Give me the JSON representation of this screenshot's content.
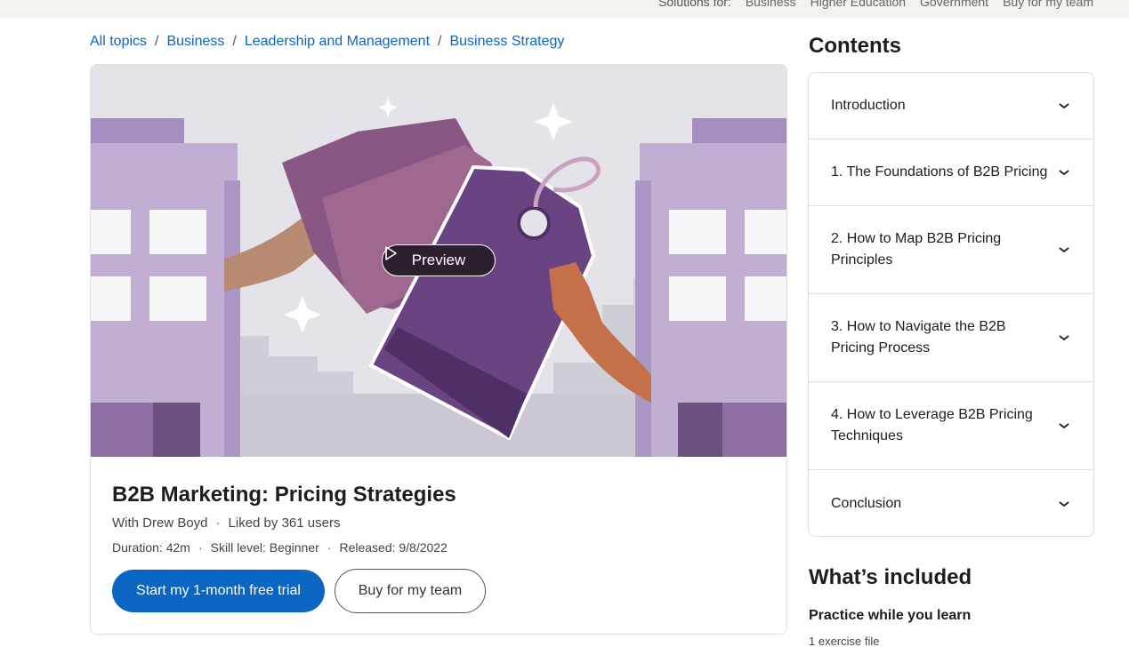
{
  "top_nav": {
    "label": "Solutions for:",
    "links": [
      "Business",
      "Higher Education",
      "Government",
      "Buy for my team"
    ]
  },
  "breadcrumb": [
    "All topics",
    "Business",
    "Leadership and Management",
    "Business Strategy"
  ],
  "course": {
    "preview_label": "Preview",
    "title": "B2B Marketing: Pricing Strategies",
    "author": "With Drew Boyd",
    "likes": "Liked by 361 users",
    "duration": "Duration: 42m",
    "skill_level": "Skill level: Beginner",
    "released": "Released: 9/8/2022",
    "primary_cta": "Start my 1-month free trial",
    "secondary_cta": "Buy for my team"
  },
  "contents": {
    "title": "Contents",
    "sections": [
      {
        "label": "Introduction"
      },
      {
        "label": "1. The Foundations of B2B Pricing"
      },
      {
        "label": "2. How to Map B2B Pricing Principles"
      },
      {
        "label": "3. How to Navigate the B2B Pricing Process"
      },
      {
        "label": "4. How to Leverage B2B Pricing Techniques"
      },
      {
        "label": "Conclusion"
      }
    ]
  },
  "included": {
    "title": "What’s included",
    "practice_title": "Practice while you learn",
    "exercise_files": "1 exercise file"
  },
  "colors": {
    "accent": "#0a66c2",
    "hero_bg": "#e4e3ea",
    "building": "#c1aed3",
    "tag": "#6a4383"
  }
}
